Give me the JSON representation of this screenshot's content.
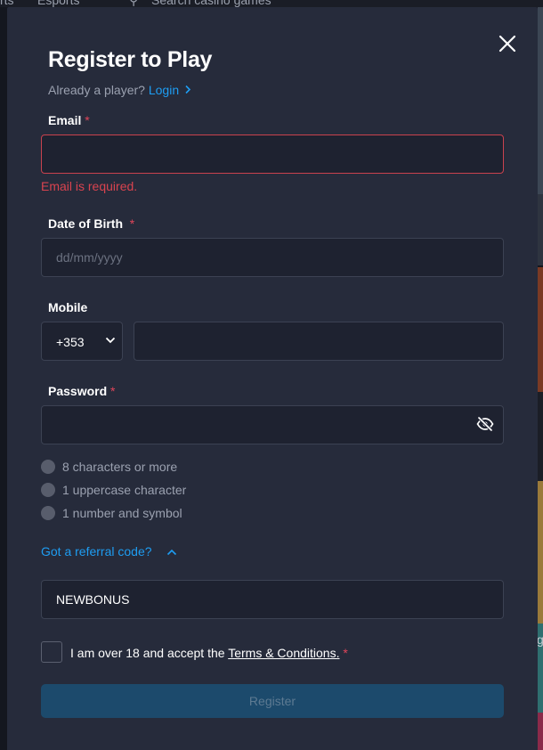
{
  "background": {
    "nav_left_fragment": "rts",
    "nav_esports": "Esports",
    "search_placeholder": "Search casino games",
    "right_edge_letter": "g"
  },
  "modal": {
    "title": "Register to Play",
    "already_text": "Already a player?",
    "login_label": "Login",
    "close_icon": "close-icon"
  },
  "form": {
    "email": {
      "label": "Email",
      "required_mark": "*",
      "value": "",
      "error": "Email is required."
    },
    "dob": {
      "label": "Date of Birth",
      "required_mark": "*",
      "placeholder": "dd/mm/yyyy",
      "value": ""
    },
    "mobile": {
      "label": "Mobile",
      "country_code": "+353",
      "value": ""
    },
    "password": {
      "label": "Password",
      "required_mark": "*",
      "value": "",
      "toggle_icon": "eye-off-icon",
      "rules": [
        "8 characters or more",
        "1 uppercase character",
        "1 number and symbol"
      ]
    },
    "referral": {
      "toggle_label": "Got a referral code?",
      "value": "NEWBONUS"
    },
    "terms": {
      "prefix": "I am over 18 and accept the",
      "link": "Terms & Conditions.",
      "required_mark": "*",
      "checked": false
    },
    "register_label": "Register"
  },
  "colors": {
    "modal_bg": "#262b3b",
    "input_bg": "#1e2230",
    "accent": "#1e9df2",
    "error": "#d9434f",
    "button_disabled_bg": "#1c4a6c"
  }
}
